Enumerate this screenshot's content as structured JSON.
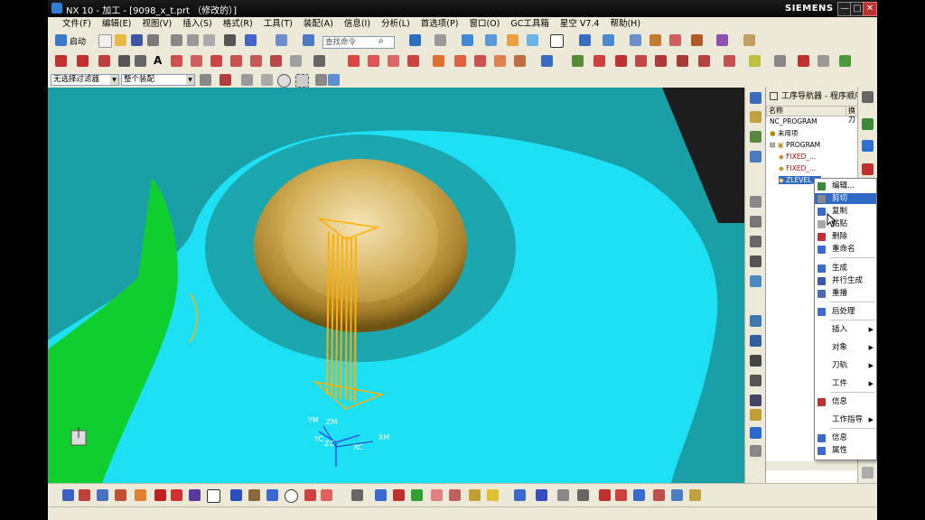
{
  "window": {
    "title": "NX 10 - 加工 - [9098_x_t.prt （修改的）]",
    "brand": "SIEMENS",
    "controls": [
      "—",
      "□",
      "✕"
    ]
  },
  "menubar": {
    "items": [
      "文件(F)",
      "编辑(E)",
      "视图(V)",
      "插入(S)",
      "格式(R)",
      "工具(T)",
      "装配(A)",
      "信息(I)",
      "分析(L)",
      "首选项(P)",
      "窗口(O)",
      "GC工具箱",
      "星空 V7.4",
      "帮助(H)"
    ]
  },
  "toolbar": {
    "start_label": "启动",
    "search_placeholder": "查找命令"
  },
  "selection": {
    "filter": "无选择过滤器",
    "scope": "整个装配"
  },
  "navigator": {
    "title": "工序导航器 - 程序顺序",
    "col_name": "名称",
    "col_tool": "换刀",
    "tree": [
      {
        "label": "NC_PROGRAM"
      },
      {
        "label": "未用项"
      },
      {
        "label": "PROGRAM"
      },
      {
        "label": "FIXED_..."
      },
      {
        "label": "FIXED_..."
      },
      {
        "label": "ZLEVEL_..."
      }
    ]
  },
  "context_menu": {
    "items": [
      "编辑...",
      "剪切",
      "复制",
      "粘贴",
      "删除",
      "重命名",
      "生成",
      "并行生成",
      "重播",
      "后处理",
      "插入",
      "对象",
      "刀轨",
      "工件",
      "信息",
      "工作指导",
      "信息",
      "属性"
    ]
  },
  "axes": {
    "zm": "ZM",
    "ym": "YM",
    "xm": "XM",
    "zc": "ZC",
    "yc": "YC",
    "xc": "XC"
  },
  "colors": {
    "viewport_bg": "#1b9fa7",
    "cyan_face": "#1ee0f5",
    "green_face": "#0fcf2f",
    "gold": "#c9a244",
    "toolpath": "#ffb000",
    "highlight": "#316ac5"
  }
}
